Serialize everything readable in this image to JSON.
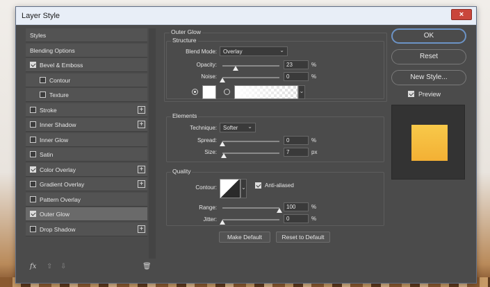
{
  "window": {
    "title": "Layer Style",
    "close": "×"
  },
  "styles_panel": {
    "items": [
      {
        "label": "Styles",
        "checkbox": false,
        "checked": false,
        "plus": false,
        "indent": false,
        "selected": false
      },
      {
        "label": "Blending Options",
        "checkbox": false,
        "checked": false,
        "plus": false,
        "indent": false,
        "selected": false
      },
      {
        "label": "Bevel & Emboss",
        "checkbox": true,
        "checked": true,
        "plus": false,
        "indent": false,
        "selected": false
      },
      {
        "label": "Contour",
        "checkbox": true,
        "checked": false,
        "plus": false,
        "indent": true,
        "selected": false
      },
      {
        "label": "Texture",
        "checkbox": true,
        "checked": false,
        "plus": false,
        "indent": true,
        "selected": false
      },
      {
        "label": "Stroke",
        "checkbox": true,
        "checked": false,
        "plus": true,
        "indent": false,
        "selected": false
      },
      {
        "label": "Inner Shadow",
        "checkbox": true,
        "checked": false,
        "plus": true,
        "indent": false,
        "selected": false
      },
      {
        "label": "Inner Glow",
        "checkbox": true,
        "checked": false,
        "plus": false,
        "indent": false,
        "selected": false
      },
      {
        "label": "Satin",
        "checkbox": true,
        "checked": false,
        "plus": false,
        "indent": false,
        "selected": false
      },
      {
        "label": "Color Overlay",
        "checkbox": true,
        "checked": true,
        "plus": true,
        "indent": false,
        "selected": false
      },
      {
        "label": "Gradient Overlay",
        "checkbox": true,
        "checked": false,
        "plus": true,
        "indent": false,
        "selected": false
      },
      {
        "label": "Pattern Overlay",
        "checkbox": true,
        "checked": false,
        "plus": false,
        "indent": false,
        "selected": false
      },
      {
        "label": "Outer Glow",
        "checkbox": true,
        "checked": true,
        "plus": false,
        "indent": false,
        "selected": true
      },
      {
        "label": "Drop Shadow",
        "checkbox": true,
        "checked": false,
        "plus": true,
        "indent": false,
        "selected": false
      }
    ],
    "footer": {
      "fx": "fx",
      "up": "⇧",
      "down": "⇩",
      "trash": "🗑"
    }
  },
  "outer_glow": {
    "title": "Outer Glow",
    "structure": {
      "title": "Structure",
      "blend_mode_label": "Blend Mode:",
      "blend_mode_value": "Overlay",
      "opacity_label": "Opacity:",
      "opacity_value": "23",
      "opacity_unit": "%",
      "opacity_level": 0.23,
      "noise_label": "Noise:",
      "noise_value": "0",
      "noise_unit": "%",
      "noise_level": 0.0
    },
    "elements": {
      "title": "Elements",
      "technique_label": "Technique:",
      "technique_value": "Softer",
      "spread_label": "Spread:",
      "spread_value": "0",
      "spread_unit": "%",
      "spread_level": 0.0,
      "size_label": "Size:",
      "size_value": "7",
      "size_unit": "px",
      "size_level": 0.03
    },
    "quality": {
      "title": "Quality",
      "contour_label": "Contour:",
      "anti_aliased_label": "Anti-aliased",
      "anti_aliased": true,
      "range_label": "Range:",
      "range_value": "100",
      "range_unit": "%",
      "range_level": 1.0,
      "jitter_label": "Jitter:",
      "jitter_value": "0",
      "jitter_unit": "%",
      "jitter_level": 0.0
    },
    "make_default": "Make Default",
    "reset_default": "Reset to Default"
  },
  "actions": {
    "ok": "OK",
    "reset": "Reset",
    "new_style": "New Style...",
    "preview_label": "Preview",
    "preview_checked": true
  },
  "colors": {
    "glow_color": "#ffffff",
    "preview_swatch": "#f5b83c",
    "accent": "#6c93c6"
  }
}
